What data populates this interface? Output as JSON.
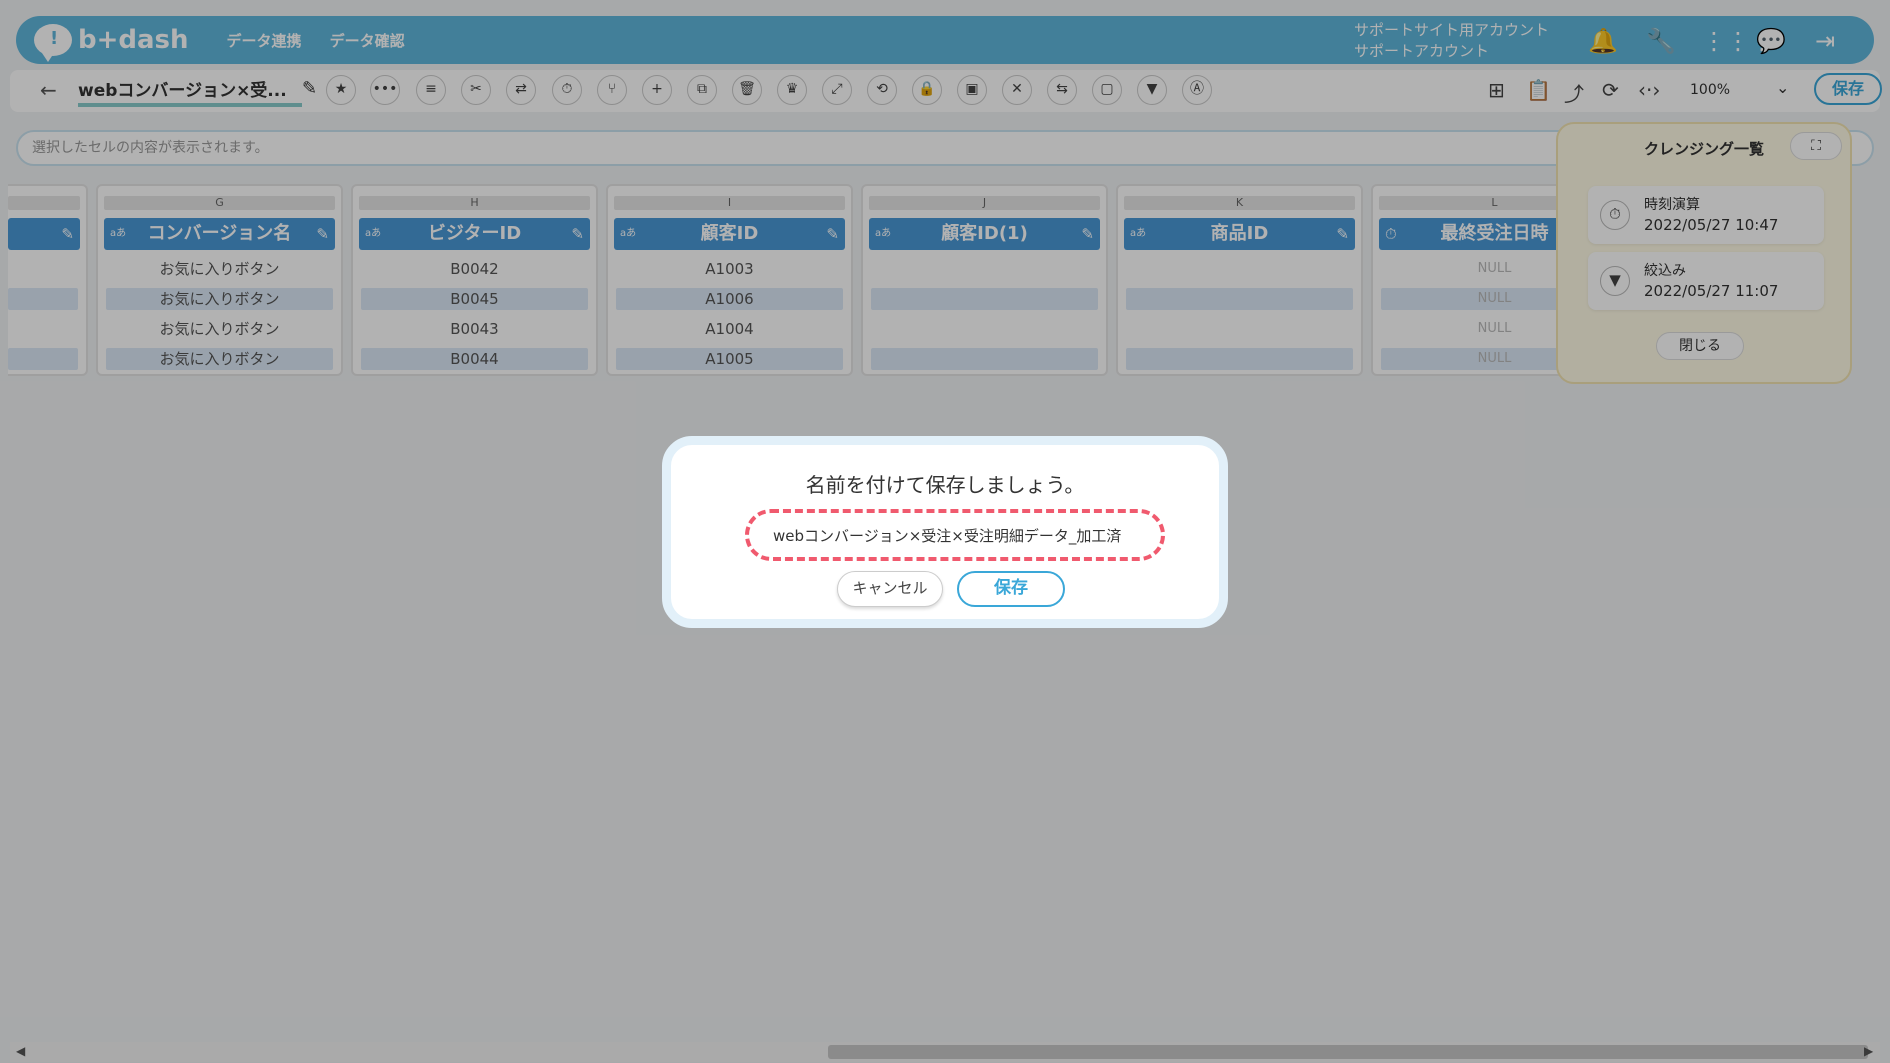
{
  "header": {
    "logo": "b+dash",
    "nav": [
      "データ連携",
      "データ確認"
    ],
    "account_line1": "サポートサイト用アカウント",
    "account_line2": "サポートアカウント",
    "icons": [
      "bell-icon",
      "wrench-icon",
      "grid-icon",
      "chat-icon",
      "logout-icon"
    ]
  },
  "toolbar": {
    "back_icon": "←",
    "title": "webコンバージョン×受...",
    "zoom": "100%",
    "save_label": "保存",
    "tools": [
      "star",
      "more",
      "list",
      "scissors",
      "swap",
      "timer",
      "branch",
      "plus",
      "copy",
      "trash",
      "crown",
      "expand",
      "repeat",
      "lock",
      "box",
      "close-circle",
      "convert",
      "frame",
      "filter",
      "text-convert"
    ],
    "right_icons": [
      "flow-icon",
      "clipboard-icon",
      "share-icon",
      "refresh-icon",
      "code-icon"
    ]
  },
  "cellbar": {
    "placeholder": "選択したセルの内容が表示されます。"
  },
  "columns": [
    {
      "letter": "G",
      "name": "コンバージョン名",
      "type": "text",
      "cells": [
        "お気に入りボタン",
        "お気に入りボタン",
        "お気に入りボタン",
        "お気に入りボタン"
      ]
    },
    {
      "letter": "H",
      "name": "ビジターID",
      "type": "text",
      "cells": [
        "B0042",
        "B0045",
        "B0043",
        "B0044"
      ]
    },
    {
      "letter": "I",
      "name": "顧客ID",
      "type": "text",
      "cells": [
        "A1003",
        "A1006",
        "A1004",
        "A1005"
      ]
    },
    {
      "letter": "J",
      "name": "顧客ID(1)",
      "type": "text",
      "cells": [
        "",
        "",
        "",
        ""
      ]
    },
    {
      "letter": "K",
      "name": "商品ID",
      "type": "text",
      "cells": [
        "",
        "",
        "",
        ""
      ]
    },
    {
      "letter": "L",
      "name": "最終受注日時",
      "type": "time",
      "cells": [
        "NULL",
        "NULL",
        "NULL",
        "NULL"
      ]
    }
  ],
  "type_badge": "aあ",
  "cleansing_panel": {
    "title": "クレンジング一覧",
    "expand_icon": "⛶",
    "steps": [
      {
        "name": "時刻演算",
        "time": "2022/05/27 10:47",
        "icon": "timer-icon"
      },
      {
        "name": "絞込み",
        "time": "2022/05/27 11:07",
        "icon": "filter-icon"
      }
    ],
    "close_label": "閉じる"
  },
  "dialog": {
    "title": "名前を付けて保存しましょう。",
    "name_value": "webコンバージョン×受注×受注明細データ_加工済",
    "cancel_label": "キャンセル",
    "save_label": "保存"
  },
  "colors": {
    "header": "#5fb6dc",
    "column_header": "#4a98d6",
    "accent": "#3aa7d8",
    "highlight_dash": "#f05a6e"
  }
}
